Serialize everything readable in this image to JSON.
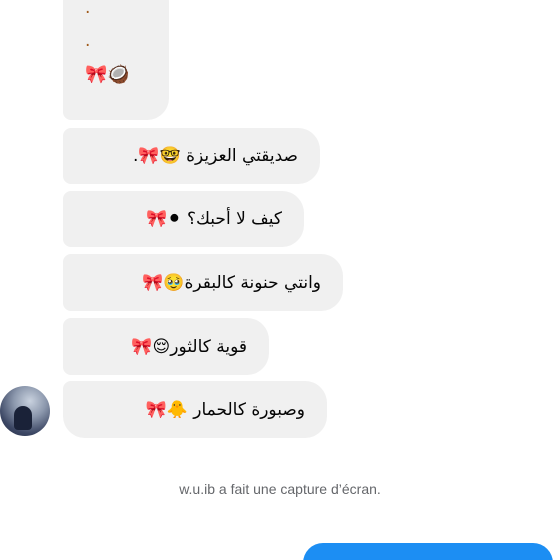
{
  "messages": [
    {
      "text": "صديقتي العزيزة 🤓🎀."
    },
    {
      "text": "كيف لا أحبك؟ ⚫🎀"
    },
    {
      "text": "وانتي حنونة كالبقرة🥹🎀"
    },
    {
      "text": "قوية كالثور😌🎀"
    },
    {
      "text": "وصبورة كالحمار 🐥🎀"
    }
  ],
  "first_message": {
    "dots": [
      ".",
      "."
    ],
    "emoji": "🎀🥥"
  },
  "notice": "w.u.ib a fait une capture d’écran."
}
